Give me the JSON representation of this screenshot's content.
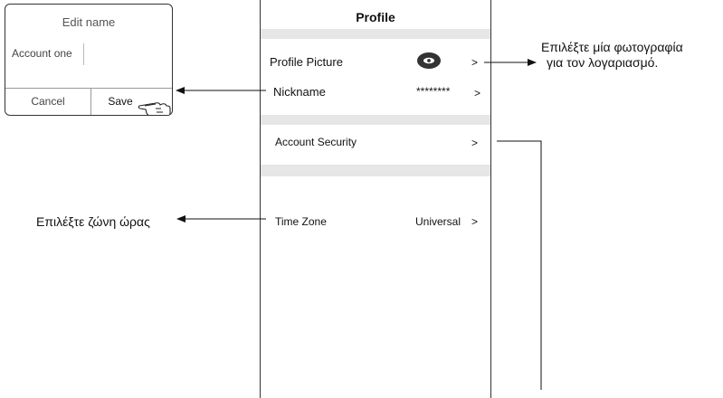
{
  "dialog": {
    "title": "Edit name",
    "input_value": "Account one",
    "cancel_label": "Cancel",
    "save_label": "Save"
  },
  "profile": {
    "title": "Profile",
    "rows": {
      "picture": {
        "label": "Profile Picture",
        "chevron": ">"
      },
      "nickname": {
        "label": "Nickname",
        "value": "********",
        "chevron": ">"
      },
      "security": {
        "label": "Account Security",
        "chevron": ">"
      },
      "timezone": {
        "label": "Time Zone",
        "value": "Universal",
        "chevron": ">"
      }
    }
  },
  "annotations": {
    "photo_line1": "Επιλέξτε μία φωτογραφία",
    "photo_line2": "για τον λογαριασμό.",
    "timezone": "Επιλέξτε ζώνη ώρας"
  },
  "icons": {
    "avatar": "avatar-icon",
    "hand": "hand-pointer-icon"
  },
  "colors": {
    "band": "#e6e6e6",
    "avatar_bg": "#333333"
  }
}
